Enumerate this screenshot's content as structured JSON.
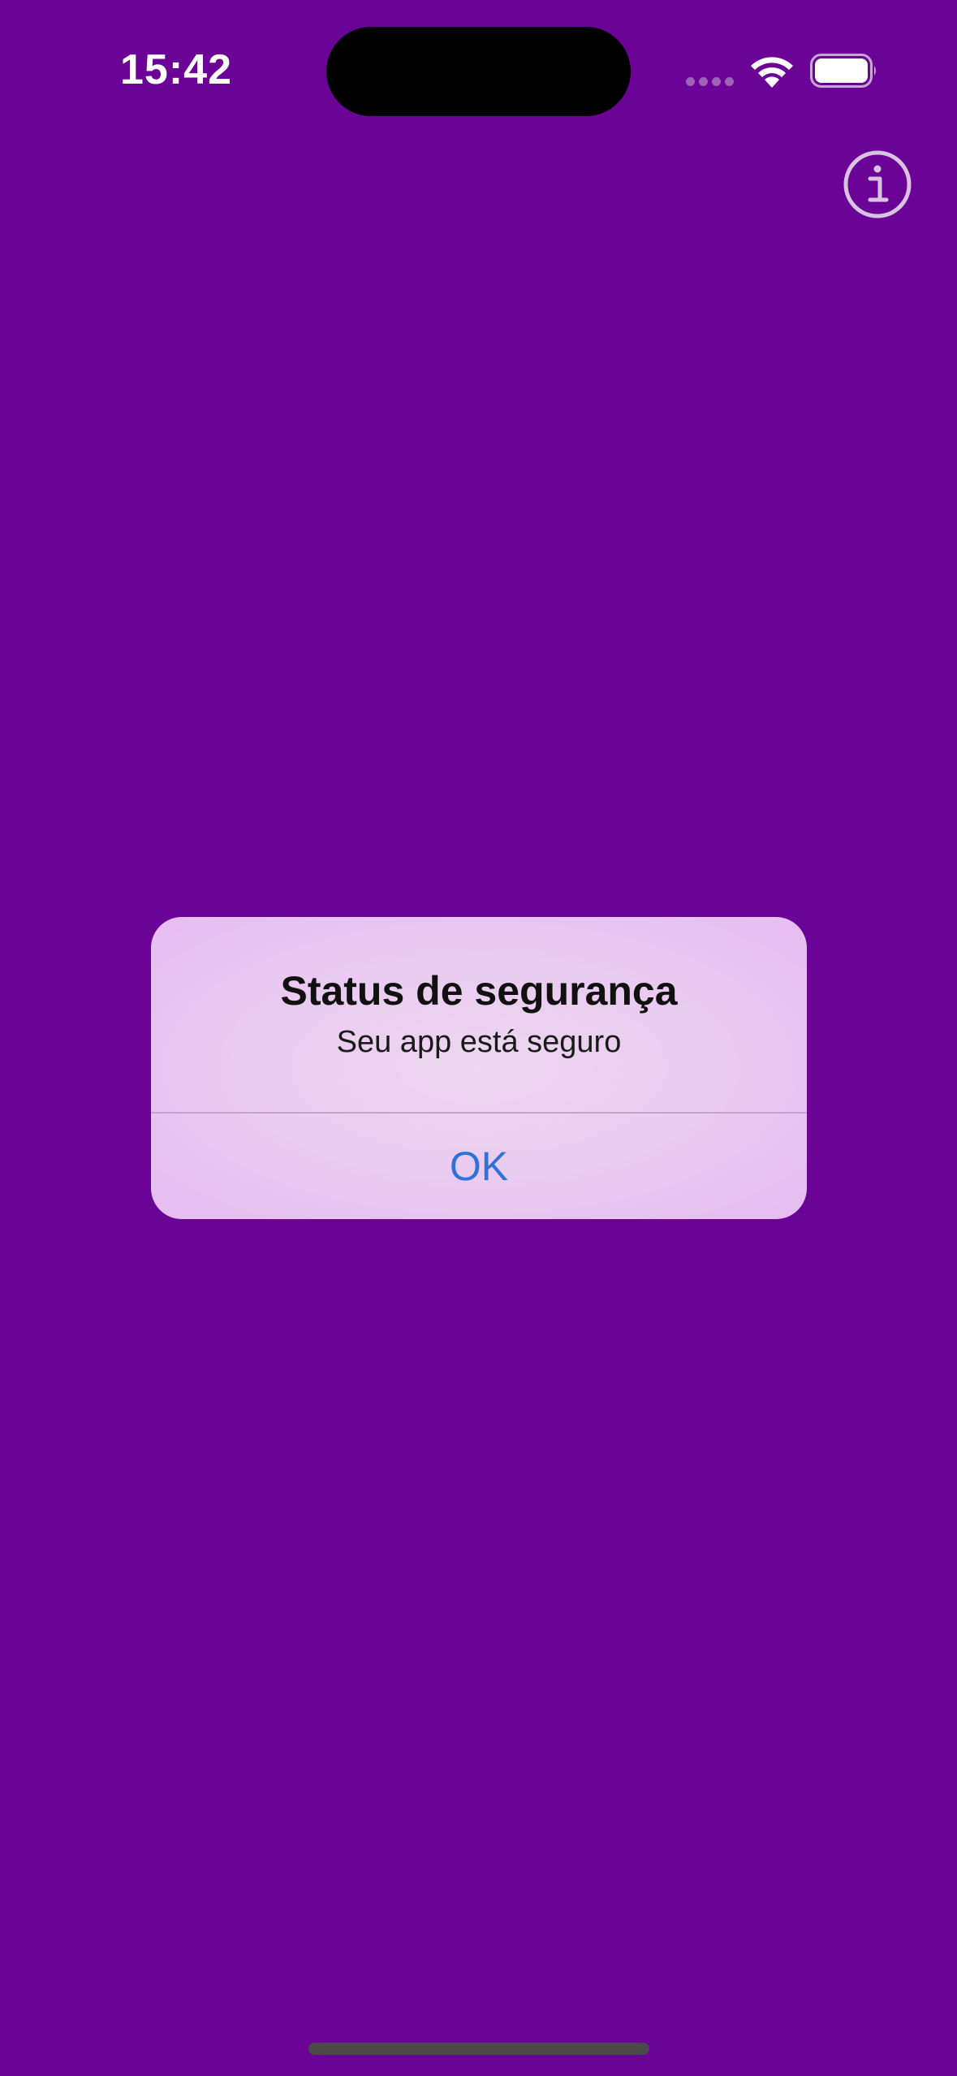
{
  "status_bar": {
    "time": "15:42"
  },
  "colors": {
    "background": "#6b0396",
    "alert_background": "#e9c9f0",
    "ok_button": "#2d73d8"
  },
  "icons": {
    "signal": "signal-icon",
    "wifi": "wifi-icon",
    "battery": "battery-icon",
    "info": "info-icon"
  },
  "alert": {
    "title": "Status de segurança",
    "message": "Seu app está seguro",
    "ok_label": "OK"
  }
}
